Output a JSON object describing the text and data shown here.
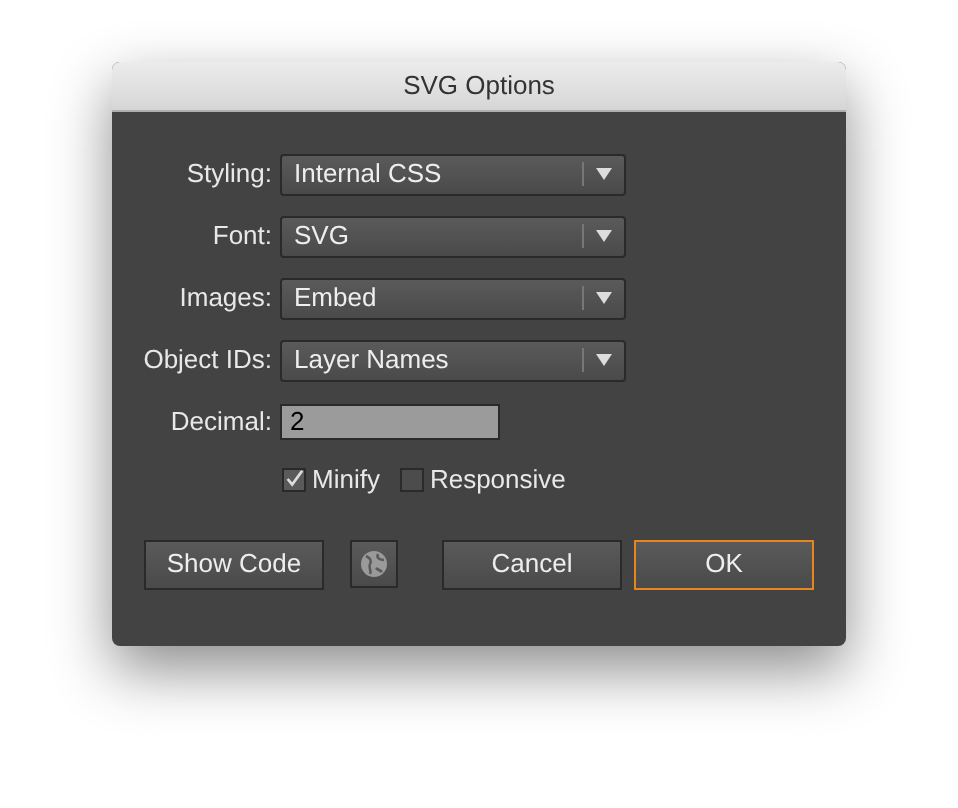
{
  "window": {
    "title": "SVG Options"
  },
  "fields": [
    {
      "label": "Styling:",
      "kind": "select",
      "value": "Internal CSS"
    },
    {
      "label": "Font:",
      "kind": "select",
      "value": "SVG"
    },
    {
      "label": "Images:",
      "kind": "select",
      "value": "Embed"
    },
    {
      "label": "Object IDs:",
      "kind": "select",
      "value": "Layer Names"
    },
    {
      "label": "Decimal:",
      "kind": "text",
      "value": "2"
    }
  ],
  "checkboxes": [
    {
      "label": "Minify",
      "checked": true
    },
    {
      "label": "Responsive",
      "checked": false
    }
  ],
  "buttons": [
    {
      "label": "Show Code",
      "kind": "text",
      "default": false
    },
    {
      "kind": "globe",
      "default": false
    },
    {
      "label": "Cancel",
      "kind": "text",
      "default": false
    },
    {
      "label": "OK",
      "kind": "text",
      "default": true
    }
  ]
}
